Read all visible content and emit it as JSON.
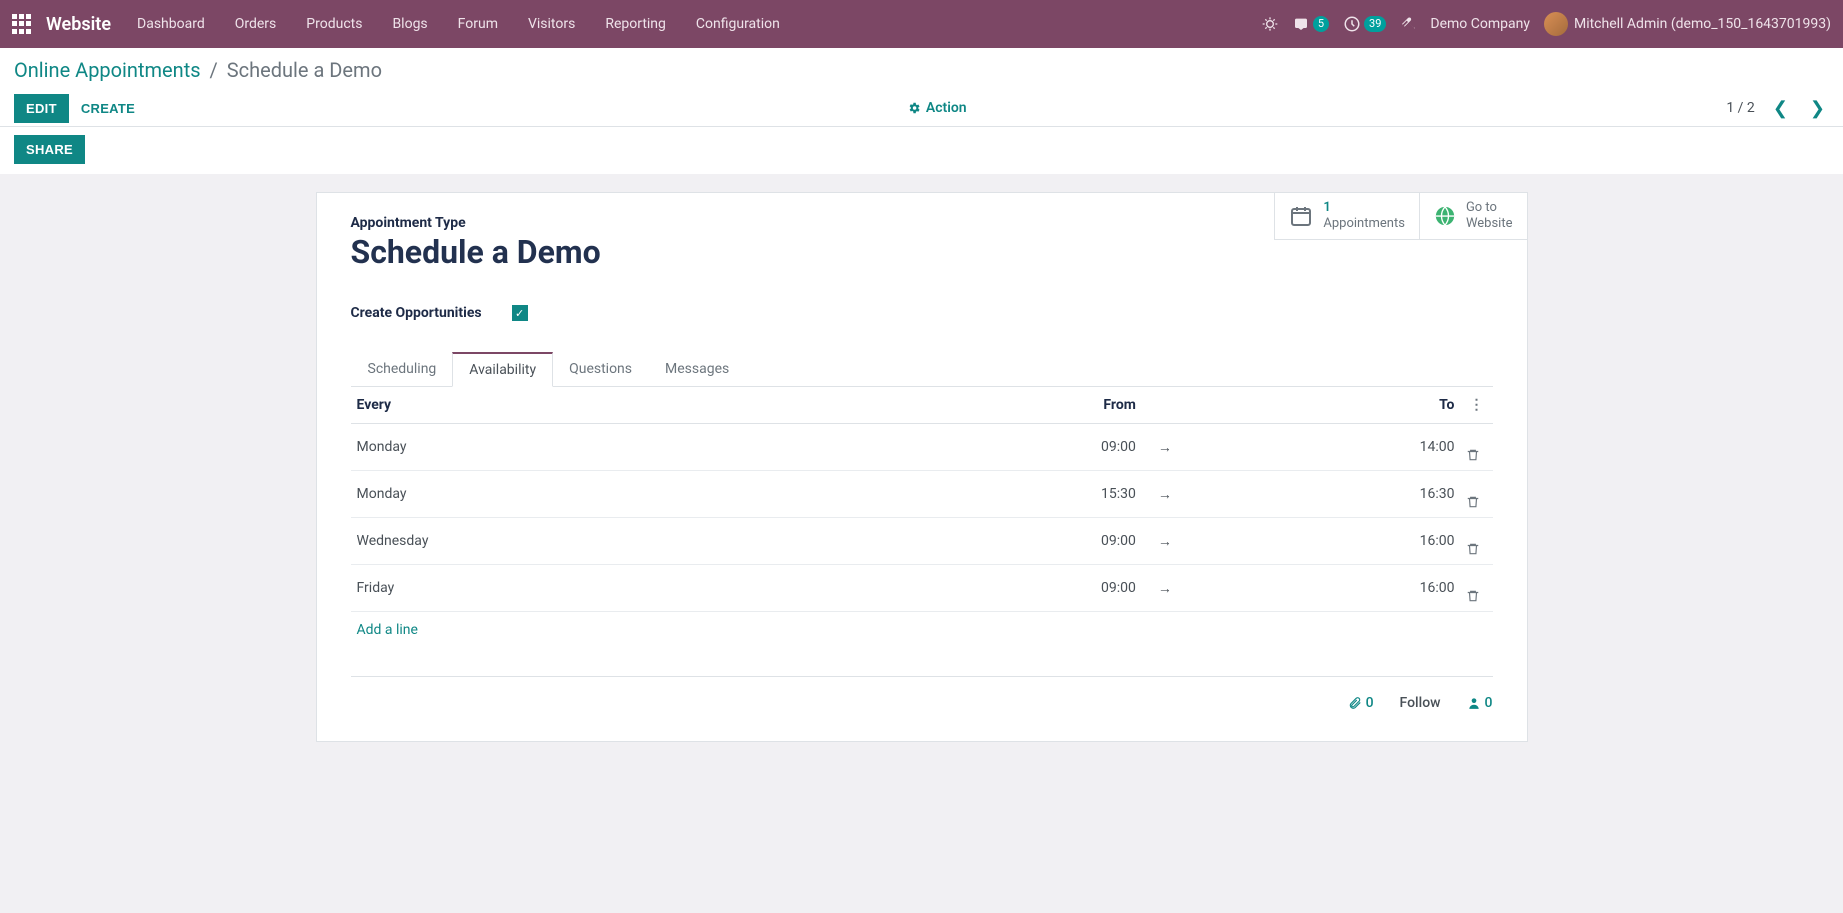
{
  "navbar": {
    "brand": "Website",
    "menu": [
      "Dashboard",
      "Orders",
      "Products",
      "Blogs",
      "Forum",
      "Visitors",
      "Reporting",
      "Configuration"
    ],
    "msg_badge": "5",
    "activity_badge": "39",
    "company": "Demo Company",
    "user": "Mitchell Admin (demo_150_1643701993)"
  },
  "breadcrumb": {
    "root": "Online Appointments",
    "leaf": "Schedule a Demo"
  },
  "buttons": {
    "edit": "EDIT",
    "create": "CREATE",
    "share": "SHARE",
    "action": "Action"
  },
  "pager": {
    "text": "1 / 2"
  },
  "stats": {
    "appointments_num": "1",
    "appointments_label": "Appointments",
    "goto_l1": "Go to",
    "goto_l2": "Website"
  },
  "form": {
    "type_label": "Appointment Type",
    "title": "Schedule a Demo",
    "create_opp_label": "Create Opportunities"
  },
  "tabs": [
    "Scheduling",
    "Availability",
    "Questions",
    "Messages"
  ],
  "table": {
    "headers": {
      "every": "Every",
      "from": "From",
      "to": "To"
    },
    "rows": [
      {
        "day": "Monday",
        "from": "09:00",
        "to": "14:00"
      },
      {
        "day": "Monday",
        "from": "15:30",
        "to": "16:30"
      },
      {
        "day": "Wednesday",
        "from": "09:00",
        "to": "16:00"
      },
      {
        "day": "Friday",
        "from": "09:00",
        "to": "16:00"
      }
    ],
    "add_line": "Add a line"
  },
  "followers": {
    "attach": "0",
    "follow": "Follow",
    "users": "0"
  }
}
